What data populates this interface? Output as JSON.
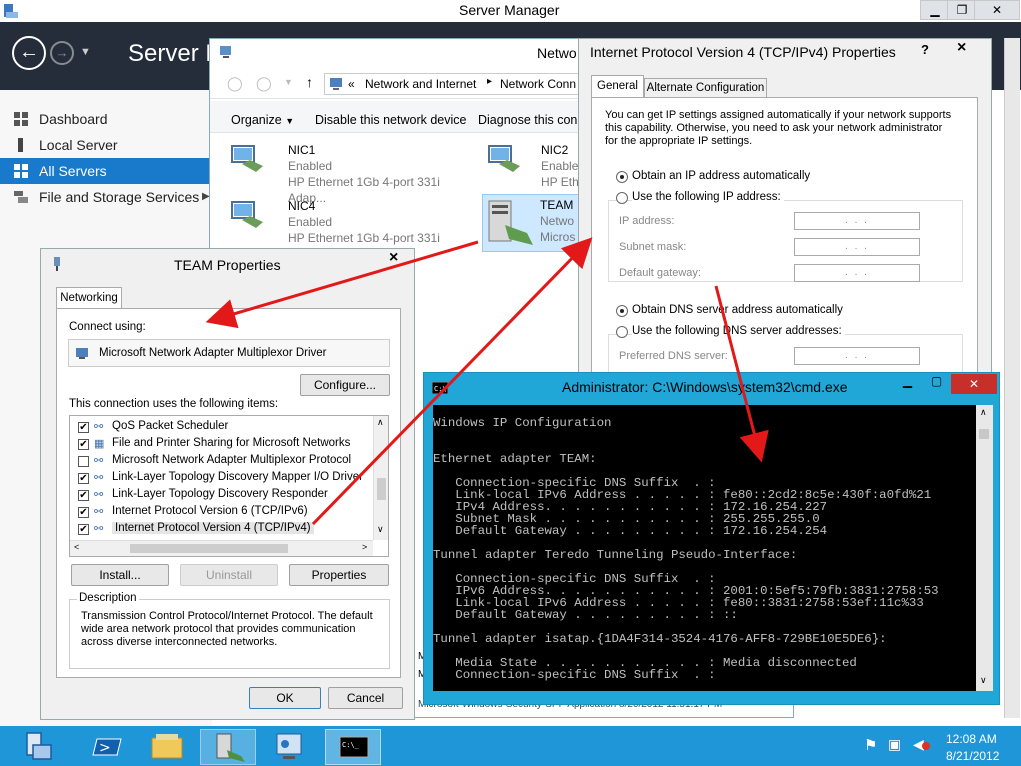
{
  "server_manager": {
    "title": "Server Manager",
    "header_title": "Server M",
    "sidebar": [
      {
        "label": "Dashboard"
      },
      {
        "label": "Local Server"
      },
      {
        "label": "All Servers"
      },
      {
        "label": "File and Storage Services"
      }
    ],
    "bottom_text": "Microsoft-Windows-Security-SPP   Application   8/20/2012 11:51:17 PM"
  },
  "network_connections": {
    "title": "Netwo",
    "breadcrumb": [
      "Network and Internet",
      "Network Conn"
    ],
    "breadcrumb_prefix": "«",
    "toolbar": [
      "Organize",
      "Disable this network device",
      "Diagnose this conn"
    ],
    "adapters": [
      {
        "name": "NIC1",
        "status": "Enabled",
        "device": "HP Ethernet 1Gb 4-port 331i Adap..."
      },
      {
        "name": "NIC2",
        "status": "Enable",
        "device": "HP Eth"
      },
      {
        "name": "NIC4",
        "status": "Enabled",
        "device": "HP Ethernet 1Gb 4-port 331i Adap..."
      },
      {
        "name": "TEAM",
        "status": "Netwo",
        "device": "Micros"
      }
    ]
  },
  "ipv4": {
    "title": "Internet Protocol Version 4 (TCP/IPv4) Properties",
    "help": "?",
    "close": "×",
    "tabs": [
      "General",
      "Alternate Configuration"
    ],
    "description": [
      "You can get IP settings assigned automatically if your network supports",
      "this capability. Otherwise, you need to ask your network administrator",
      "for the appropriate IP settings."
    ],
    "auto_ip": "Obtain an IP address automatically",
    "manual_ip": "Use the following IP address:",
    "ip_label": "IP address:",
    "mask_label": "Subnet mask:",
    "gateway_label": "Default gateway:",
    "ip_placeholder": ".     .     .",
    "auto_dns": "Obtain DNS server address automatically",
    "manual_dns": "Use the following DNS server addresses:",
    "preferred_dns": "Preferred DNS server:"
  },
  "team": {
    "title": "TEAM Properties",
    "close": "×",
    "tab": "Networking",
    "connect_using": "Connect using:",
    "adapter": "Microsoft Network Adapter Multiplexor Driver",
    "configure": "Configure...",
    "items_label": "This connection uses the following items:",
    "items": [
      {
        "label": "QoS Packet Scheduler",
        "checked": true
      },
      {
        "label": "File and Printer Sharing for Microsoft Networks",
        "checked": true
      },
      {
        "label": "Microsoft Network Adapter Multiplexor Protocol",
        "checked": false
      },
      {
        "label": "Link-Layer Topology Discovery Mapper I/O Driver",
        "checked": true
      },
      {
        "label": "Link-Layer Topology Discovery Responder",
        "checked": true
      },
      {
        "label": "Internet Protocol Version 6 (TCP/IPv6)",
        "checked": true
      },
      {
        "label": "Internet Protocol Version 4 (TCP/IPv4)",
        "checked": true
      }
    ],
    "install": "Install...",
    "uninstall": "Uninstall",
    "properties": "Properties",
    "description_label": "Description",
    "description": [
      "Transmission Control Protocol/Internet Protocol. The default",
      "wide area network protocol that provides communication",
      "across diverse interconnected networks."
    ],
    "ok": "OK",
    "cancel": "Cancel"
  },
  "cmd": {
    "title": "Administrator: C:\\Windows\\system32\\cmd.exe",
    "lines": [
      "Windows IP Configuration",
      "",
      "",
      "Ethernet adapter TEAM:",
      "",
      "   Connection-specific DNS Suffix  . :",
      "   Link-local IPv6 Address . . . . . : fe80::2cd2:8c5e:430f:a0fd%21",
      "   IPv4 Address. . . . . . . . . . . : 172.16.254.227",
      "   Subnet Mask . . . . . . . . . . . : 255.255.255.0",
      "   Default Gateway . . . . . . . . . : 172.16.254.254",
      "",
      "Tunnel adapter Teredo Tunneling Pseudo-Interface:",
      "",
      "   Connection-specific DNS Suffix  . :",
      "   IPv6 Address. . . . . . . . . . . : 2001:0:5ef5:79fb:3831:2758:53",
      "   Link-local IPv6 Address . . . . . : fe80::3831:2758:53ef:11c%33",
      "   Default Gateway . . . . . . . . . : ::",
      "",
      "Tunnel adapter isatap.{1DA4F314-3524-4176-AFF8-729BE10E5DE6}:",
      "",
      "   Media State . . . . . . . . . . . : Media disconnected",
      "   Connection-specific DNS Suffix  . :"
    ]
  },
  "taskbar": {
    "time": "12:08 AM",
    "date": "8/21/2012"
  },
  "colors": {
    "accent": "#1979ca",
    "taskbar": "#1e96d8",
    "arrow": "#e31919",
    "cmd_frame": "#20a7d8"
  }
}
